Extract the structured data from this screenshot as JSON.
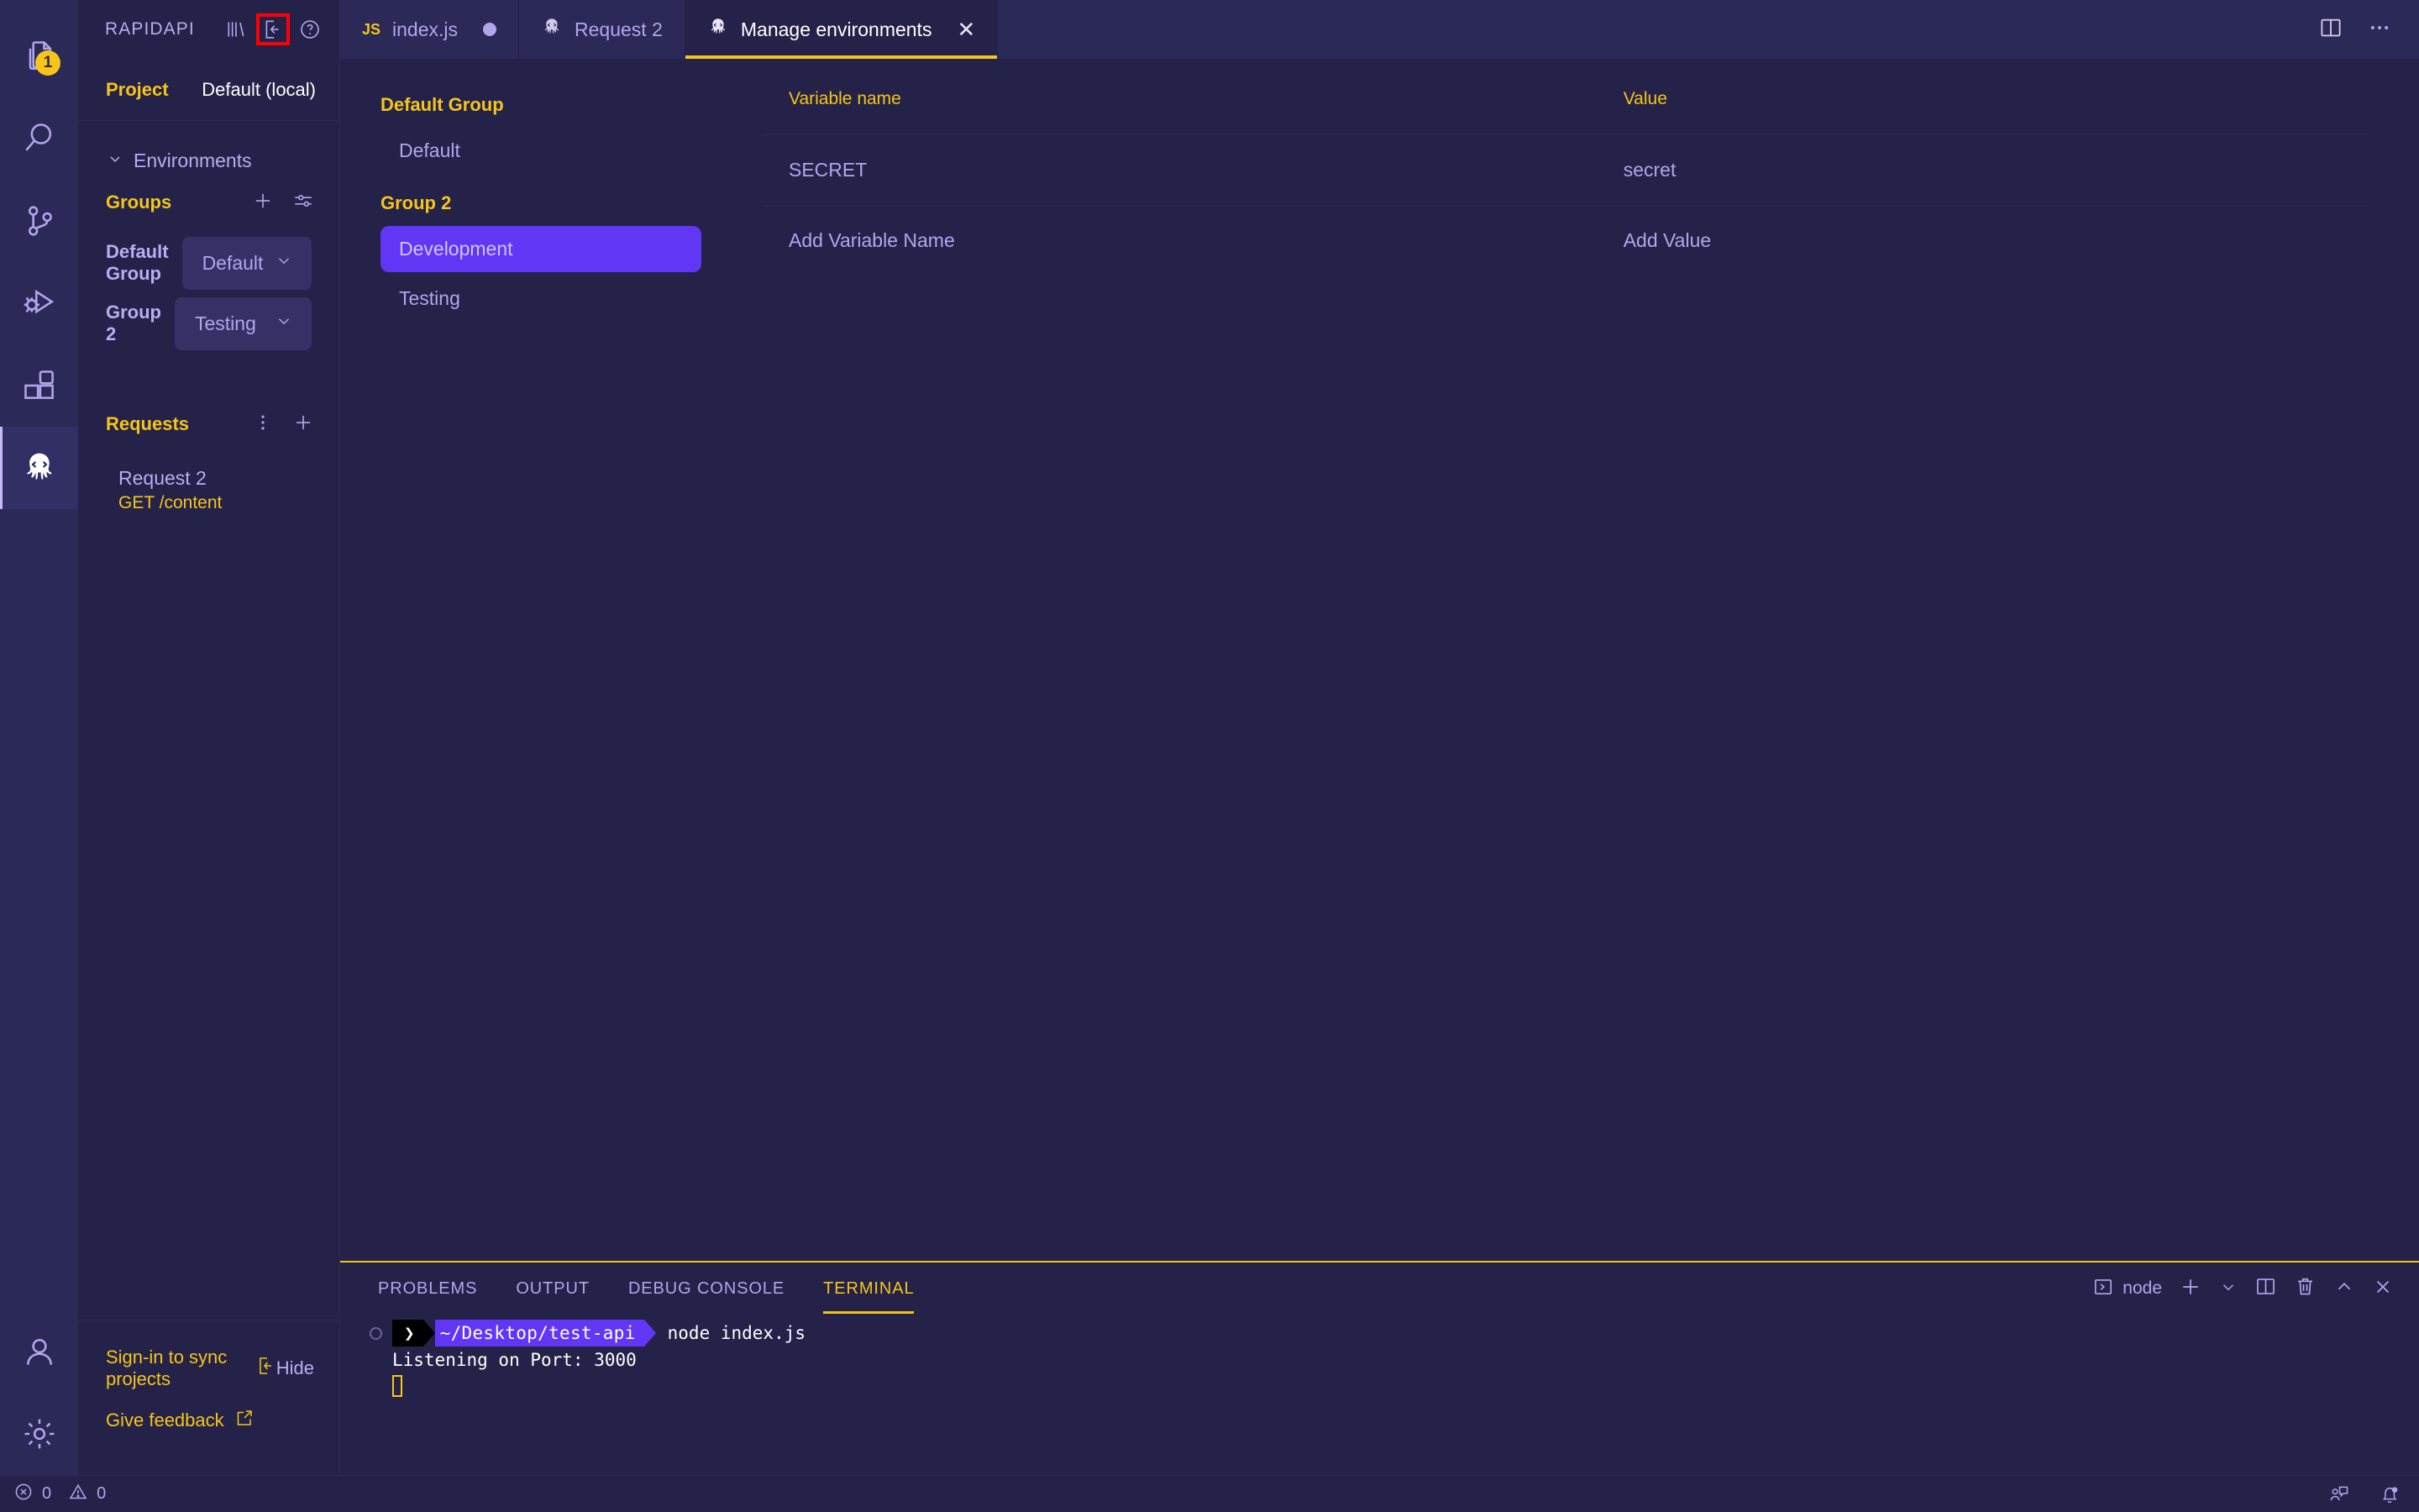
{
  "activity_bar": {
    "items": [
      {
        "name": "explorer",
        "icon": "files-icon",
        "badge": "1",
        "active": false
      },
      {
        "name": "search",
        "icon": "search-icon",
        "badge": "",
        "active": false
      },
      {
        "name": "source-control",
        "icon": "source-control-icon",
        "badge": "",
        "active": false
      },
      {
        "name": "run-debug",
        "icon": "run-and-debug-icon",
        "badge": "",
        "active": false
      },
      {
        "name": "extensions",
        "icon": "extensions-icon",
        "badge": "",
        "active": false
      },
      {
        "name": "rapidapi",
        "icon": "octopus-icon",
        "badge": "",
        "active": true
      }
    ],
    "bottom_items": [
      {
        "name": "accounts",
        "icon": "account-icon"
      },
      {
        "name": "settings",
        "icon": "gear-icon"
      }
    ]
  },
  "sidebar": {
    "title": "RAPIDAPI",
    "header_icons": [
      {
        "name": "library-icon",
        "highlighted": false
      },
      {
        "name": "sign-in-icon",
        "highlighted": true
      },
      {
        "name": "help-icon",
        "highlighted": false
      }
    ],
    "project": {
      "label": "Project",
      "value": "Default (local)"
    },
    "environments_section": {
      "label": "Environments",
      "expanded": true
    },
    "groups_section": {
      "title": "Groups",
      "add_icon": "plus-icon",
      "settings_icon": "sliders-icon",
      "rows": [
        {
          "name": "Default Group",
          "selected": "Default"
        },
        {
          "name": "Group 2",
          "selected": "Testing"
        }
      ]
    },
    "requests_section": {
      "title": "Requests",
      "more_icon": "kebab-menu-icon",
      "add_icon": "plus-icon",
      "items": [
        {
          "title": "Request 2",
          "meta": "GET /content"
        }
      ]
    },
    "footer": {
      "signin_label": "Sign-in to sync projects",
      "signin_icon": "sign-in-icon",
      "hide_label": "Hide",
      "feedback_label": "Give feedback",
      "feedback_icon": "external-link-icon"
    }
  },
  "editor": {
    "tabs": [
      {
        "label": "index.js",
        "icon": "js-file-icon",
        "icon_text": "JS",
        "dirty": true,
        "active": false,
        "closable": false
      },
      {
        "label": "Request 2",
        "icon": "octopus-icon",
        "dirty": false,
        "active": false,
        "closable": false
      },
      {
        "label": "Manage environments",
        "icon": "octopus-icon",
        "dirty": false,
        "active": true,
        "closable": true
      }
    ],
    "tabbar_actions": [
      {
        "name": "split-editor-icon"
      },
      {
        "name": "more-actions-icon"
      }
    ],
    "environment_list": {
      "groups": [
        {
          "label": "Default Group",
          "items": [
            {
              "label": "Default",
              "selected": false
            }
          ]
        },
        {
          "label": "Group 2",
          "items": [
            {
              "label": "Development",
              "selected": true
            },
            {
              "label": "Testing",
              "selected": false
            }
          ]
        }
      ]
    },
    "variables": {
      "columns": [
        "Variable name",
        "Value"
      ],
      "rows": [
        {
          "name": "SECRET",
          "value": "secret"
        },
        {
          "name": "Add Variable Name",
          "value": "Add Value"
        }
      ]
    }
  },
  "panel": {
    "tabs": [
      {
        "label": "PROBLEMS",
        "active": false
      },
      {
        "label": "OUTPUT",
        "active": false
      },
      {
        "label": "DEBUG CONSOLE",
        "active": false
      },
      {
        "label": "TERMINAL",
        "active": true
      }
    ],
    "actions": {
      "shell_icon": "terminal-icon",
      "shell_label": "node",
      "new_terminal_icon": "plus-icon",
      "dropdown_icon": "chevron-down-icon",
      "split_icon": "split-terminal-icon",
      "kill_icon": "trash-icon",
      "maximize_icon": "chevron-up-icon",
      "close_icon": "close-icon"
    },
    "terminal": {
      "prompt_arrow": "❯",
      "prompt_path": "~/Desktop/test-api",
      "command": "node index.js",
      "output": "Listening on Port: 3000"
    }
  },
  "status_bar": {
    "errors_icon": "error-icon",
    "errors_count": "0",
    "warnings_icon": "warning-icon",
    "warnings_count": "0",
    "right_items": [
      {
        "name": "feedback-icon"
      },
      {
        "name": "bell-icon"
      }
    ]
  },
  "colors": {
    "background": "#242248",
    "panel_chrome": "#2b2957",
    "accent_yellow": "#f5c518",
    "accent_purple": "#6236f5",
    "text_purple": "#b0a6ec",
    "highlight_red": "#ff0000"
  }
}
